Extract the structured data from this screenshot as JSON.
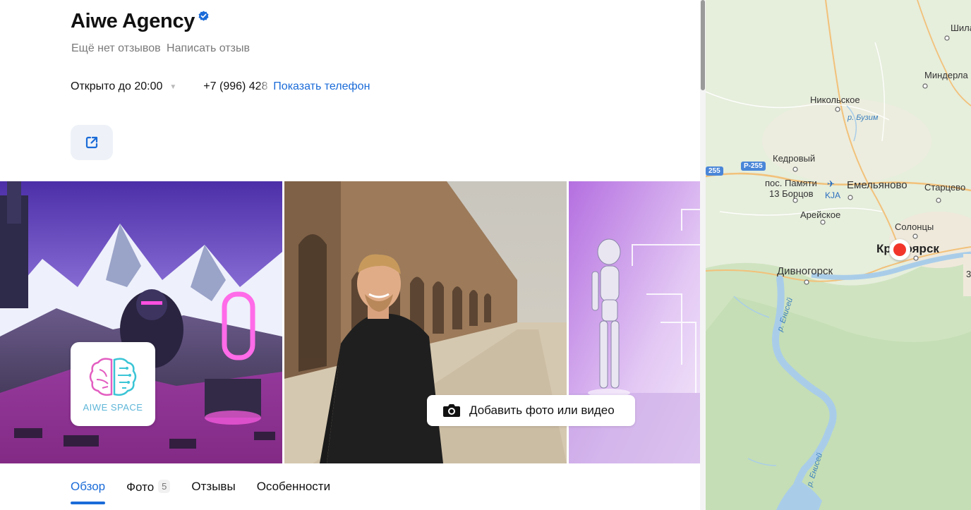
{
  "business": {
    "name": "Aiwe Agency",
    "no_reviews": "Ещё нет отзывов",
    "write_review": "Написать отзыв",
    "hours": "Открыто до 20:00",
    "phone_partial": "+7 (996) 428",
    "show_phone": "Показать телефон"
  },
  "gallery": {
    "logo_text": "AIWE SPACE",
    "add_media": "Добавить фото или видео"
  },
  "tabs": [
    {
      "label": "Обзор",
      "active": true
    },
    {
      "label": "Фото",
      "count": "5"
    },
    {
      "label": "Отзывы"
    },
    {
      "label": "Особенности"
    }
  ],
  "map": {
    "labels": {
      "shila": "Шила",
      "minderla": "Миндерла",
      "nikolskoe": "Никольское",
      "buzim": "р. Бузим",
      "kedrovy": "Кедровый",
      "pos_pamyati": "пос. Памяти",
      "borcov": "13 Борцов",
      "kja": "KJA",
      "emelyanovo": "Емельяново",
      "startsevo": "Старцево",
      "areyskoe": "Арейское",
      "solontsy": "Солонцы",
      "krasnoyarsk": "Кр  ноярск",
      "divnogorsk": "Дивногорск",
      "enisey1": "р. Енисей",
      "enisey2": "р. Енисей",
      "edge3": "3"
    },
    "roads": [
      "Р-255",
      "255"
    ]
  },
  "colors": {
    "accent": "#1a6bd8",
    "pin": "#f2352a",
    "map_bg": "#e6eedc",
    "water": "#a9cde9"
  }
}
